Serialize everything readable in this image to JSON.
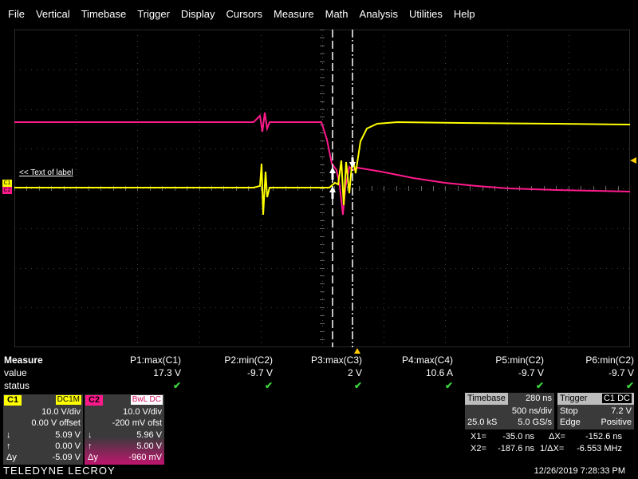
{
  "menu": [
    "File",
    "Vertical",
    "Timebase",
    "Trigger",
    "Display",
    "Cursors",
    "Measure",
    "Math",
    "Analysis",
    "Utilities",
    "Help"
  ],
  "graticule": {
    "label": "<< Text of label"
  },
  "channel_markers": {
    "c1": "C1",
    "c2": "C2"
  },
  "measure": {
    "title": "Measure",
    "row_value": "value",
    "row_status": "status",
    "params": [
      {
        "name": "P1:max(C1)",
        "value": "17.3 V"
      },
      {
        "name": "P2:min(C2)",
        "value": "-9.7 V"
      },
      {
        "name": "P3:max(C3)",
        "value": "2 V"
      },
      {
        "name": "P4:max(C4)",
        "value": "10.6 A"
      },
      {
        "name": "P5:min(C2)",
        "value": "-9.7 V"
      },
      {
        "name": "P6:min(C2)",
        "value": "-9.7 V"
      }
    ],
    "status_glyph": "✔"
  },
  "ch1": {
    "badge": "C1",
    "coupling": "DC1M",
    "vdiv": "10.0 V/div",
    "offset": "0.00 V offset",
    "cursor_down_sym": "↓",
    "cursor_down": "5.09 V",
    "cursor_up_sym": "↑",
    "cursor_up": "0.00 V",
    "dy_sym": "Δy",
    "dy": "-5.09 V",
    "color": "#ffff00"
  },
  "ch2": {
    "badge": "C2",
    "coupling": "BwL DC",
    "vdiv": "10.0 V/div",
    "offset": "-200 mV ofst",
    "cursor_down_sym": "↓",
    "cursor_down": "5.96 V",
    "cursor_up_sym": "↑",
    "cursor_up": "5.00 V",
    "dy_sym": "Δy",
    "dy": "-960 mV",
    "color": "#ff1a8c"
  },
  "timebase": {
    "label": "Timebase",
    "delay": "280 ns",
    "tdiv": "500 ns/div",
    "samples": "25.0 kS",
    "rate": "5.0 GS/s"
  },
  "trigger": {
    "label": "Trigger",
    "source": "C1 DC",
    "mode": "Stop",
    "level": "7.2 V",
    "type": "Edge",
    "slope": "Positive"
  },
  "cursors": {
    "x1_label": "X1=",
    "x1": "-35.0 ns",
    "dx_label": "ΔX=",
    "dx": "-152.6 ns",
    "x2_label": "X2=",
    "x2": "-187.6 ns",
    "inv_dx_label": "1/ΔX=",
    "inv_dx": "-6.553 MHz"
  },
  "brand": "TELEDYNE LECROY",
  "datetime": "12/26/2019 7:28:33 PM"
}
